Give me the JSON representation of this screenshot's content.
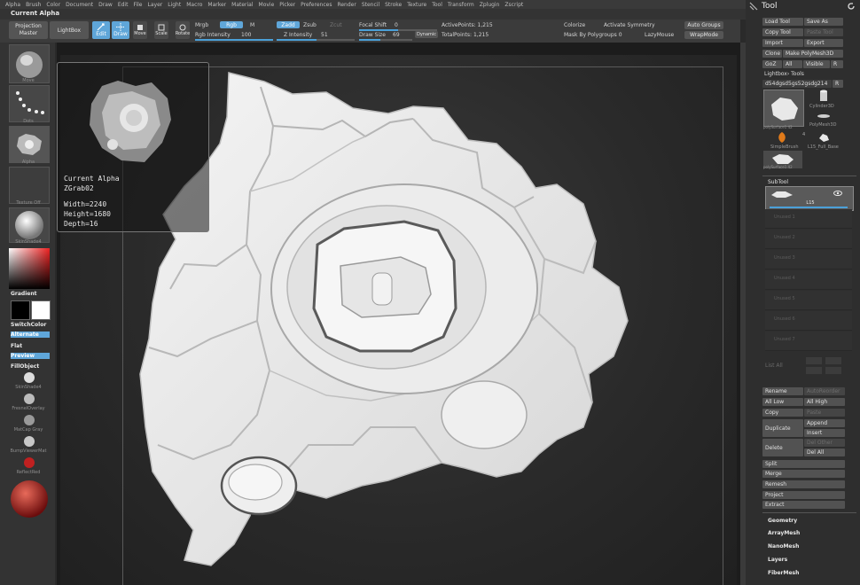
{
  "menubar": [
    "Alpha",
    "Brush",
    "Color",
    "Document",
    "Draw",
    "Edit",
    "File",
    "Layer",
    "Light",
    "Macro",
    "Marker",
    "Material",
    "Movie",
    "Picker",
    "Preferences",
    "Render",
    "Stencil",
    "Stroke",
    "Texture",
    "Tool",
    "Transform",
    "Zplugin",
    "Zscript"
  ],
  "current_alpha_label": "Current Alpha",
  "shelf": {
    "projection_master": "Projection\nMaster",
    "lightbox": "LightBox",
    "edit": "Edit",
    "draw": "Draw",
    "move": "Move",
    "scale": "Scale",
    "rotate": "Rotate",
    "mrgb": "Mrgb",
    "rgb": "Rgb",
    "m": "M",
    "rgb_intensity_label": "Rgb Intensity",
    "rgb_intensity_value": "100",
    "zadd": "Zadd",
    "zsub": "Zsub",
    "zcut": "Zcut",
    "z_intensity_label": "Z Intensity",
    "z_intensity_value": "51",
    "focal_shift_label": "Focal Shift",
    "focal_shift_value": "0",
    "draw_size_label": "Draw Size",
    "draw_size_value": "69",
    "dynamic": "Dynamic",
    "active_points": "ActivePoints: 1,215",
    "total_points": "TotalPoints: 1,215",
    "colorize": "Colorize",
    "activate_symmetry": "Activate Symmetry",
    "mask_by_polygroups": "Mask By Polygroups 0",
    "lazymouse": "LazyMouse",
    "auto_groups": "Auto Groups",
    "wrapmode": "WrapMode"
  },
  "left": {
    "brush_label": "Move",
    "stroke_label": "Dots",
    "alpha_label": "Alpha",
    "texture_label": "Texture Off",
    "material_label": "SkinShade4",
    "gradient": "Gradient",
    "switchcolor": "SwitchColor",
    "alternate": "Alternate",
    "flat": "Flat",
    "preview": "Preview",
    "fillobject": "FillObject",
    "mat1": "SkinShade4",
    "mat2": "FresnelOverlay",
    "mat3": "MatCap Gray",
    "mat4": "BumpViewerMat",
    "mat5": "ReflectRed"
  },
  "popup": {
    "title": "Current Alpha",
    "name": "ZGrab02",
    "width": "Width=2240",
    "height": "Height=1680",
    "depth": "Depth=16"
  },
  "right": {
    "title": "Tool",
    "load_tool": "Load Tool",
    "save_as": "Save As",
    "copy_tool": "Copy Tool",
    "paste_tool": "Paste Tool",
    "import": "Import",
    "export": "Export",
    "clone": "Clone",
    "make_polymesh": "Make PolyMesh3D",
    "goz": "GoZ",
    "all": "All",
    "visible": "Visible",
    "r": "R",
    "lightbox_tools": "Lightbox› Tools",
    "tool_name": "d54dgsd5gs52gsdg214",
    "r2": "R",
    "items": [
      "polySurface1 42",
      "Cylinder3D",
      "PolyMesh3D",
      "SimpleBrush",
      "L15_Full_Base",
      "polySurface1 42"
    ],
    "count": "4",
    "subtool": "SubTool",
    "subtool_active": "L15",
    "subtool_slots": [
      "Unused 1",
      "Unused 2",
      "Unused 3",
      "Unused 4",
      "Unused 5",
      "Unused 6",
      "Unused 7"
    ],
    "list_all": "List All",
    "rename": "Rename",
    "autoreorder": "AutoReorder",
    "all_low": "All Low",
    "all_high": "All High",
    "copy": "Copy",
    "paste": "Paste",
    "duplicate": "Duplicate",
    "append": "Append",
    "insert": "Insert",
    "delete": "Delete",
    "del_other": "Del Other",
    "del_all": "Del All",
    "split": "Split",
    "merge": "Merge",
    "remesh": "Remesh",
    "project": "Project",
    "extract": "Extract",
    "sections": [
      "Geometry",
      "ArrayMesh",
      "NanoMesh",
      "Layers",
      "FiberMesh"
    ]
  },
  "colors": {
    "accent": "#5fa6d9",
    "panel": "#2e2e2e",
    "mesh": "#e9e9e9"
  }
}
